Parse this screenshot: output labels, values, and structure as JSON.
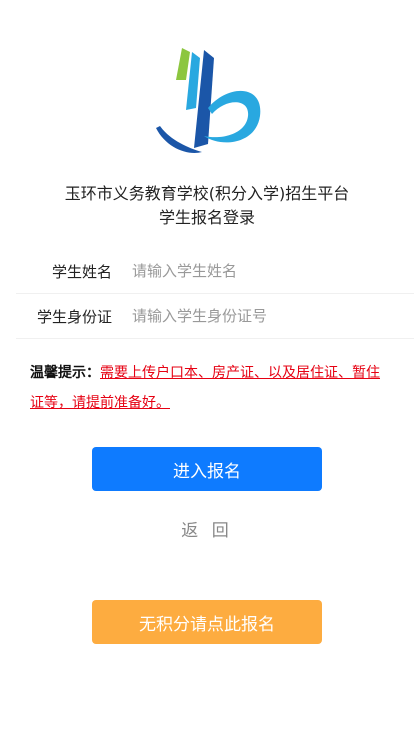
{
  "header": {
    "title_line1": "玉环市义务教育学校(积分入学)招生平台",
    "title_line2": "学生报名登录"
  },
  "form": {
    "name_label": "学生姓名",
    "name_placeholder": "请输入学生姓名",
    "name_value": "",
    "id_label": "学生身份证",
    "id_placeholder": "请输入学生身份证号",
    "id_value": ""
  },
  "notice": {
    "heading": "温馨提示：",
    "text": "需要上传户口本、房产证、以及居住证、暂住证等，请提前准备好。"
  },
  "buttons": {
    "enter": "进入报名",
    "back": "返 回",
    "no_points": "无积分请点此报名"
  },
  "colors": {
    "primary": "#0e7bff",
    "secondary": "#fdac40",
    "notice_red": "#e60012",
    "logo_green": "#8cc63f",
    "logo_blue": "#1b56a8",
    "logo_cyan": "#29a8e0"
  },
  "icons": {
    "logo": "school-logo-icon"
  }
}
